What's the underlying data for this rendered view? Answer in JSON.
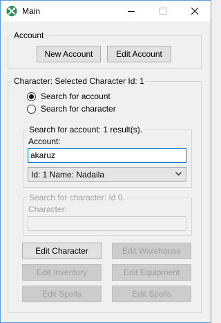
{
  "window": {
    "title": "Main"
  },
  "account": {
    "legend": "Account",
    "new_account_label": "New Account",
    "edit_account_label": "Edit Account"
  },
  "character": {
    "legend": "Character: Selected Character Id: 1",
    "radio_search_account": "Search for account",
    "radio_search_character": "Search for character",
    "search_account": {
      "legend": "Search for account: 1 result(s).",
      "account_label": "Account:",
      "account_value": "akaruz",
      "result_selected": "Id: 1 Name: Nadaila"
    },
    "search_character": {
      "legend": "Search for character: Id 0.",
      "character_label": "Character:",
      "character_value": ""
    },
    "buttons": {
      "edit_character": "Edit Character",
      "edit_warehouse": "Edit Warehouse",
      "edit_inventory": "Edit Inventory",
      "edit_equipment": "Edit Equipment",
      "edit_spells_left": "Edit Spells",
      "edit_spells_right": "Edit Spells"
    }
  },
  "icons": {
    "app": "wrench-cross-icon",
    "minimize": "minimize-icon",
    "maximize": "maximize-icon",
    "close": "close-icon",
    "dropdown": "chevron-down-icon"
  },
  "colors": {
    "window_bg": "#f0f0f0",
    "focus_border": "#0078d7",
    "app_icon": "#2e8b57",
    "disabled_text": "#a0a0a0"
  }
}
